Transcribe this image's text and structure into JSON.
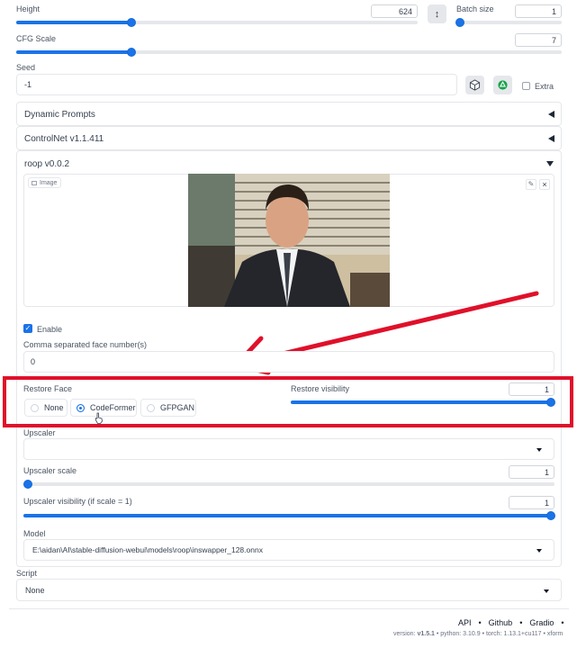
{
  "height": {
    "label": "Height",
    "value": "624",
    "fraction": 0.34
  },
  "batch_size": {
    "label": "Batch size",
    "value": "1",
    "fraction": 0.0
  },
  "swap_icon": "↕",
  "cfg_scale": {
    "label": "CFG Scale",
    "value": "7",
    "fraction": 0.21
  },
  "seed": {
    "label": "Seed",
    "value": "-1",
    "extra_label": "Extra"
  },
  "accordions": {
    "dynamic_prompts": "Dynamic Prompts",
    "controlnet": "ControlNet v1.1.411",
    "roop": "roop v0.0.2"
  },
  "roop": {
    "image_label": "Image",
    "enable_label": "Enable",
    "face_numbers_label": "Comma separated face number(s)",
    "face_numbers_value": "0",
    "restore_face_label": "Restore Face",
    "restore_options": [
      "None",
      "CodeFormer",
      "GFPGAN"
    ],
    "restore_selected": "CodeFormer",
    "restore_visibility_label": "Restore visibility",
    "restore_visibility_value": "1",
    "upscaler_label": "Upscaler",
    "upscaler_value": "",
    "upscaler_scale_label": "Upscaler scale",
    "upscaler_scale_value": "1",
    "upscaler_visibility_label": "Upscaler visibility (if scale = 1)",
    "upscaler_visibility_value": "1",
    "model_label": "Model",
    "model_value": "E:\\aidan\\AI\\stable-diffusion-webui\\models\\roop\\inswapper_128.onnx"
  },
  "script": {
    "label": "Script",
    "value": "None"
  },
  "footer": {
    "links": [
      "API",
      "•",
      "Github",
      "•",
      "Gradio",
      "•"
    ],
    "version_prefix": "version: ",
    "version": "v1.5.1",
    "python_label": "  •  python: 3.10.9  •  torch: 1.13.1+cu117  •  xform"
  },
  "colors": {
    "accent": "#1a73e8",
    "annotation": "#e0102a"
  }
}
